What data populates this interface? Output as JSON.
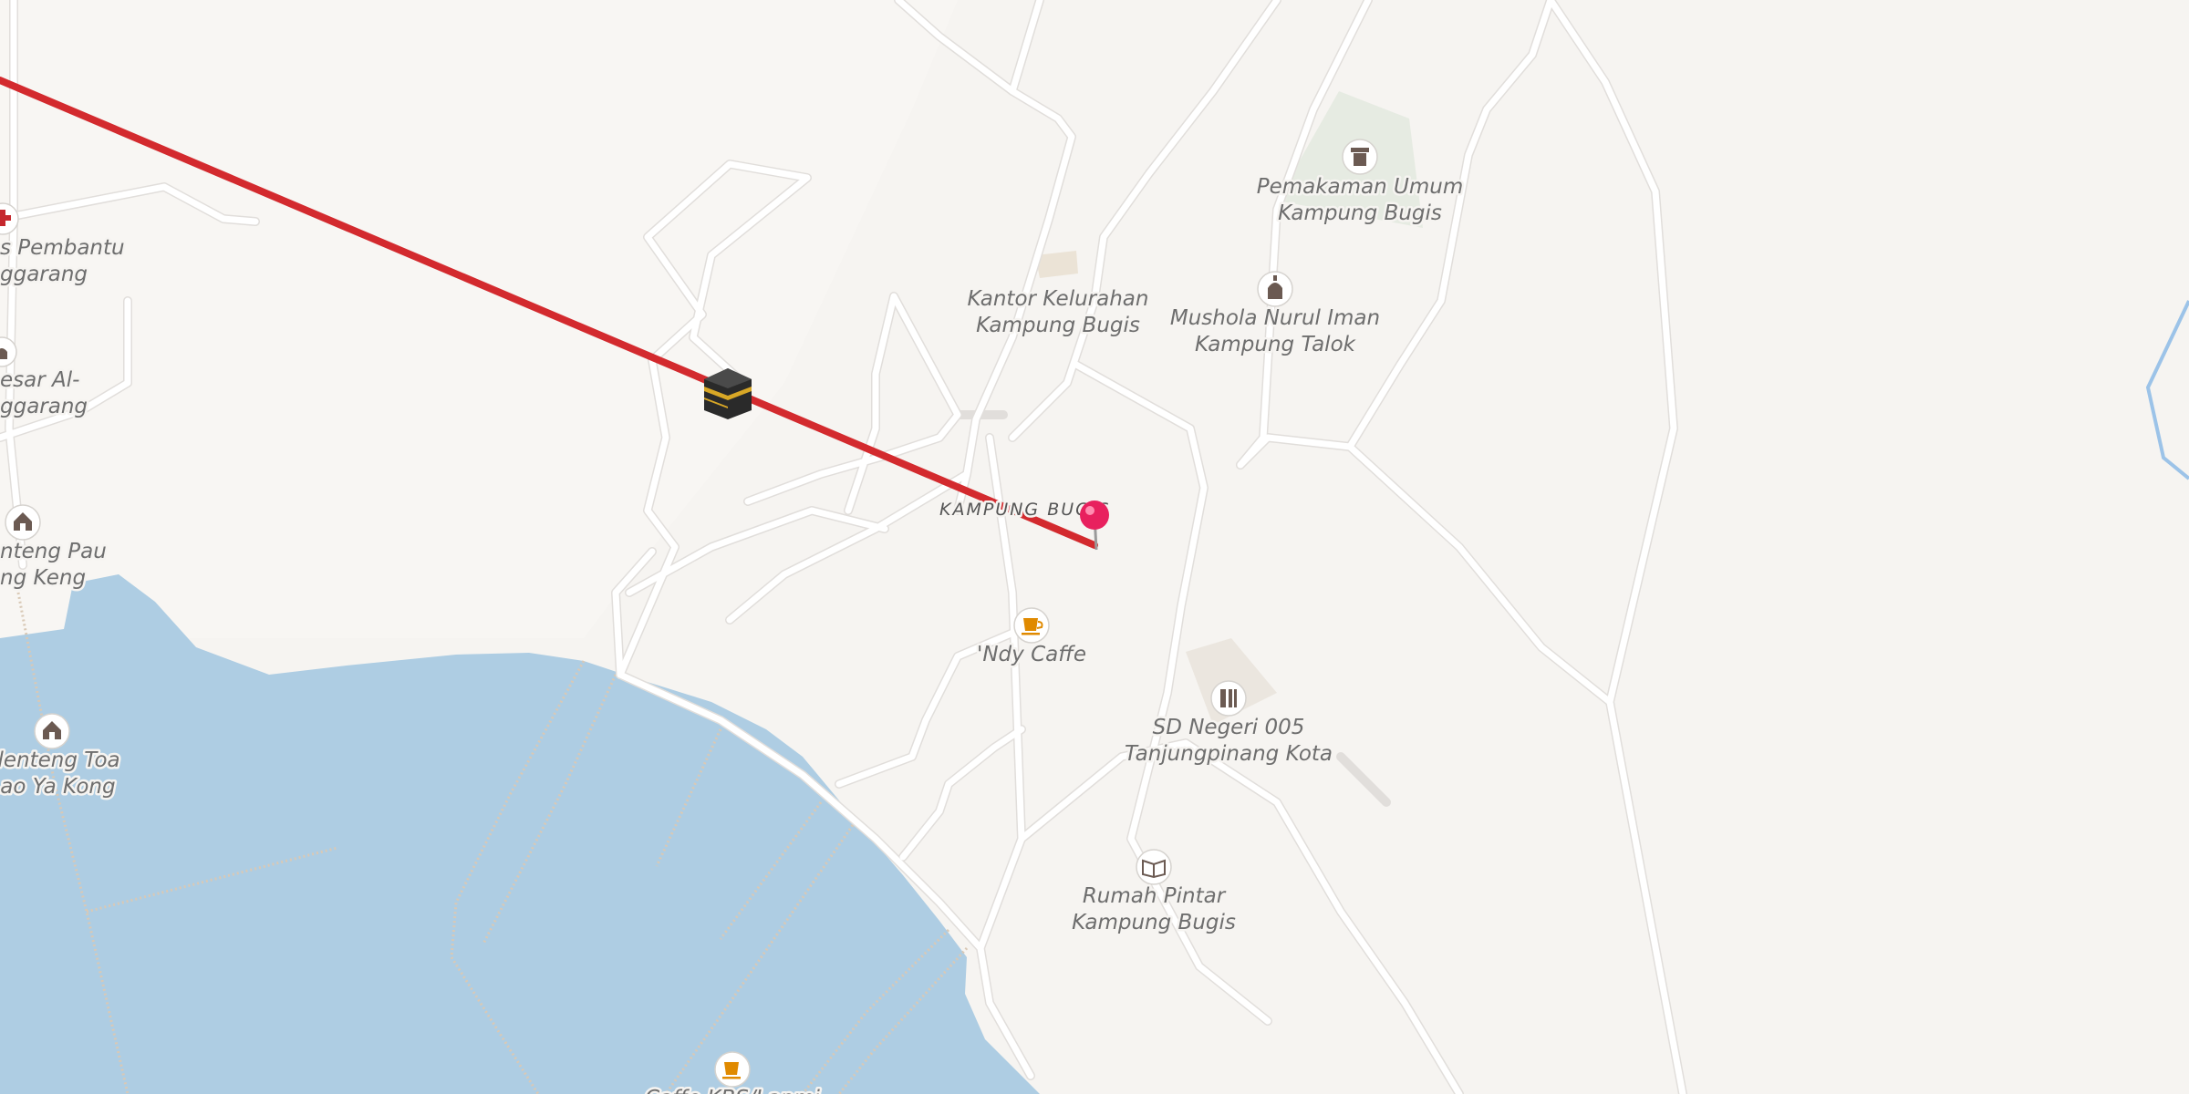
{
  "map": {
    "area_label": "KAMPUNG BUGIS",
    "colors": {
      "land": "#f6f4f1",
      "water": "#aecde3",
      "road": "#ffffff",
      "route": "#d32a2e",
      "pin": "#e8205e",
      "cafe": "#e08a00",
      "poi_icon": "#6b5a52"
    },
    "pois": [
      {
        "key": "kantor",
        "line1": "Kantor Kelurahan",
        "line2": "Kampung Bugis",
        "icon": "building-icon"
      },
      {
        "key": "pemakaman",
        "line1": "Pemakaman Umum",
        "line2": "Kampung Bugis",
        "icon": "cemetery-icon"
      },
      {
        "key": "mushola",
        "line1": "Mushola Nurul Iman",
        "line2": "Kampung Talok",
        "icon": "mosque-icon"
      },
      {
        "key": "ndy",
        "line1": "'Ndy Caffe",
        "line2": "",
        "icon": "cafe-icon"
      },
      {
        "key": "sd",
        "line1": "SD Negeri 005",
        "line2": "Tanjungpinang Kota",
        "icon": "school-icon"
      },
      {
        "key": "rumah",
        "line1": "Rumah Pintar",
        "line2": "Kampung Bugis",
        "icon": "book-icon"
      },
      {
        "key": "pustu",
        "line1": "s Pembantu",
        "line2": "ggarang",
        "icon": "medical-cross-icon"
      },
      {
        "key": "masjid",
        "line1": "esar Al-",
        "line2": "ggarang",
        "icon": "mosque-icon"
      },
      {
        "key": "kelenteng_pau",
        "line1": "nteng Pau",
        "line2": "ng Keng",
        "icon": "temple-icon"
      },
      {
        "key": "klenteng_toa",
        "line1": "Klenteng Toa",
        "line2": "Lao Ya Kong",
        "icon": "temple-icon"
      },
      {
        "key": "caffe_kbs",
        "line1": "Caffe KBS/Lapmi",
        "line2": "",
        "icon": "cafe-icon"
      }
    ],
    "route_icon": "kaaba-icon",
    "pin_icon": "location-pin-icon"
  }
}
